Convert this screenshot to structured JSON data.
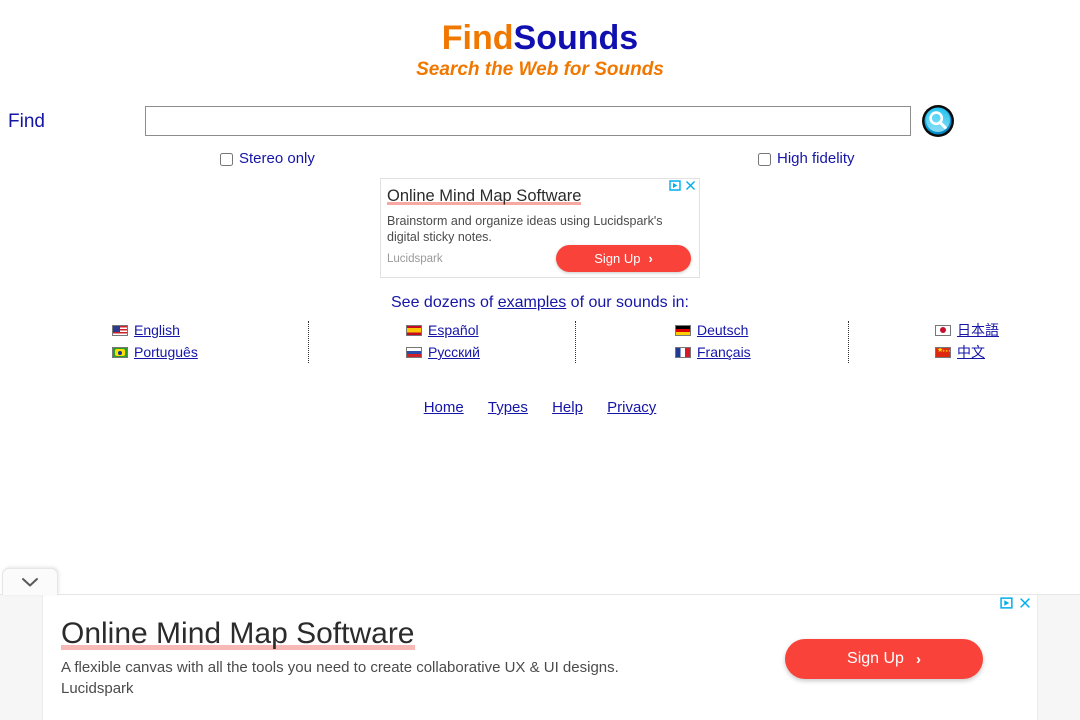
{
  "site": {
    "logo_part1": "Find",
    "logo_part2": "Sounds",
    "tagline": "Search the Web for Sounds"
  },
  "search": {
    "find_label": "Find",
    "input_value": "",
    "input_placeholder": "",
    "button_icon": "magnifier-icon",
    "options": [
      {
        "id": "stereo",
        "label": "Stereo only",
        "checked": false
      },
      {
        "id": "hifi",
        "label": "High fidelity",
        "checked": false
      }
    ]
  },
  "ad_top": {
    "headline": "Online Mind Map Software",
    "body": "Brainstorm and organize ideas using Lucidspark's digital sticky notes.",
    "brand": "Lucidspark",
    "cta_label": "Sign Up",
    "cta_chevron": "›",
    "adchoices_icon": "adchoices-triangle-icon",
    "close_icon": "✕",
    "cta_color": "#F8423A",
    "accent_color": "#00AEEF"
  },
  "examples": {
    "prefix": "See dozens of ",
    "link": "examples",
    "suffix": " of our sounds in:"
  },
  "languages": {
    "columns": [
      {
        "items": [
          {
            "label": "English",
            "flag": "flag-us",
            "flag_name": "flag-united-states-icon"
          },
          {
            "label": "Português",
            "flag": "flag-br",
            "flag_name": "flag-brazil-icon"
          }
        ]
      },
      {
        "items": [
          {
            "label": "Español",
            "flag": "flag-es",
            "flag_name": "flag-spain-icon"
          },
          {
            "label": "Русский",
            "flag": "flag-ru",
            "flag_name": "flag-russia-icon"
          }
        ]
      },
      {
        "items": [
          {
            "label": "Deutsch",
            "flag": "flag-de",
            "flag_name": "flag-germany-icon"
          },
          {
            "label": "Français",
            "flag": "flag-fr",
            "flag_name": "flag-france-icon"
          }
        ]
      },
      {
        "items": [
          {
            "label": "日本語",
            "flag": "flag-jp",
            "flag_name": "flag-japan-icon"
          },
          {
            "label": "中文",
            "flag": "flag-cn",
            "flag_name": "flag-china-icon"
          }
        ]
      }
    ]
  },
  "footer_nav": {
    "links": [
      {
        "label": "Home"
      },
      {
        "label": "Types"
      },
      {
        "label": "Help"
      },
      {
        "label": "Privacy"
      }
    ]
  },
  "ad_bottom": {
    "collapse_icon": "chevron-down-icon",
    "headline": "Online Mind Map Software",
    "body": "A flexible canvas with all the tools you need to create collaborative UX & UI designs.",
    "brand": "Lucidspark",
    "cta_label": "Sign Up",
    "cta_chevron": "›",
    "adchoices_icon": "adchoices-triangle-icon",
    "close_icon": "✕",
    "cta_color": "#F8423A"
  },
  "colors": {
    "link": "#1515A8",
    "logo_orange": "#F07800",
    "logo_blue": "#1010B0",
    "ad_red": "#F8423A",
    "adchoices_cyan": "#00AEEF"
  }
}
